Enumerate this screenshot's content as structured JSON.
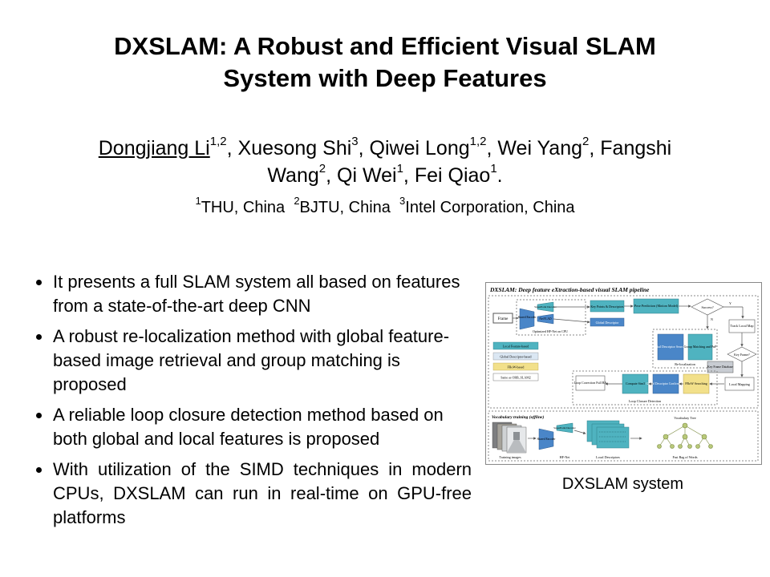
{
  "title": {
    "line1": "DXSLAM: A Robust and Efficient Visual SLAM",
    "line2": "System with Deep Features"
  },
  "authors": {
    "a1_name": "Dongjiang Li",
    "a1_sup": "1,2",
    "a2_name": "Xuesong Shi",
    "a2_sup": "3",
    "a3_name": "Qiwei Long",
    "a3_sup": "1,2",
    "a4_name": "Wei Yang",
    "a4_sup": "2",
    "a5_name_1": "Fangshi",
    "a5_name_2": "Wang",
    "a5_sup": "2",
    "a6_name": "Qi Wei",
    "a6_sup": "1",
    "a7_name": "Fei Qiao",
    "a7_sup": "1"
  },
  "affiliations": [
    {
      "sup": "1",
      "text": "THU, China"
    },
    {
      "sup": "2",
      "text": "BJTU, China"
    },
    {
      "sup": "3",
      "text": "Intel Corporation, China"
    }
  ],
  "bullets": [
    "It presents a full SLAM system all based on features from a state-of-the-art deep CNN",
    "A robust re-localization method with global feature-based image retrieval and group matching is proposed",
    "A reliable loop closure detection method based on both global and local features is proposed",
    "With utilization of the SIMD techniques in modern CPUs, DXSLAM can run in real-time on GPU-free platforms"
  ],
  "figure": {
    "title": "DXSLAM: Deep feature eXtraction-based visual SLAM pipeline",
    "frame": "Frame",
    "shared_encoder": "Shared Encoder",
    "superpoint_decoder": "SuperPoint Decoder",
    "netvlad": "NetVLAD",
    "optimized_hfnet": "Optimized HF-Net on CPU",
    "keypoints": "Key Points & Descriptors",
    "global_descriptor": "Global Descriptor",
    "pose_prediction": "Pose Prediction (Motion Model)",
    "success": "Success?",
    "y": "Y",
    "n": "N",
    "track_local_map": "Track Local Map",
    "global_desc_search": "Global Descriptor Searching",
    "group_matching": "Group Matching and PnP",
    "relocalization": "Re-localization",
    "key_frame": "Key Frame?",
    "kf_database": "Key Frame Database",
    "local_mapping": "Local Mapping",
    "legend_local": "Local Feature-based",
    "legend_global": "Global Descriptor-based",
    "legend_fbow": "FBoW-based",
    "legend_orb": "Same as ORB_SLAM2",
    "loop_correction": "Loop Correction Full BA",
    "compute_sim3": "Compute Sim3",
    "global_desc_conf": "Global Descriptor Confirmation",
    "fbow_searching": "FBoW Searching",
    "loop_closure": "Loop Closure Detection",
    "vocab_training": "Vocabulary training (offline)",
    "vocab_tree": "Vocabulary Tree",
    "training_images": "Training images",
    "hfnet": "HF-Net",
    "local_descriptors": "Local Descriptors",
    "fast_bow": "Fast Bag of Words"
  },
  "caption": "DXSLAM system",
  "colors": {
    "teal": "#4fb3c0",
    "blue": "#4a86c8",
    "green": "#8fc79a",
    "yellow": "#f2e08a",
    "tree": "#b9c97a"
  }
}
